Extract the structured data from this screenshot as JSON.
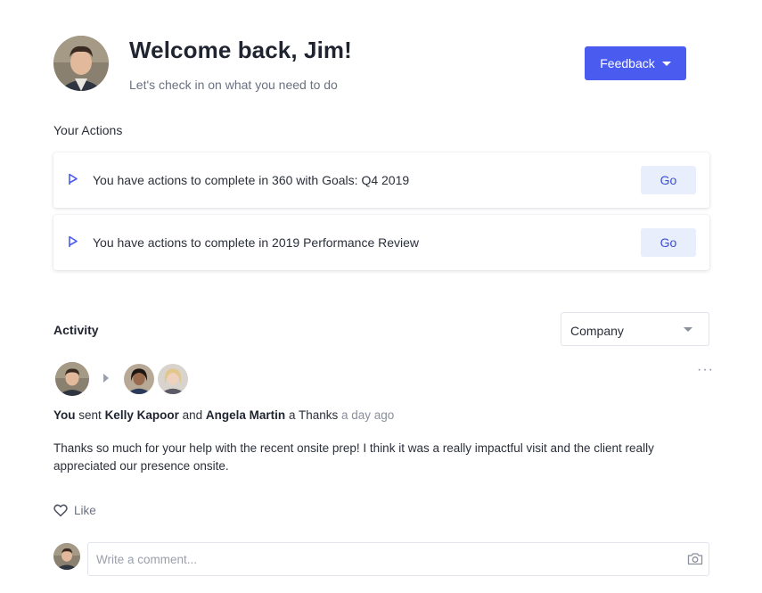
{
  "header": {
    "title": "Welcome back, Jim!",
    "subtitle": "Let's check in on what you need to do",
    "avatar_icon": "user-avatar-jim",
    "feedback_label": "Feedback",
    "accent_color": "#4a5bef"
  },
  "actions": {
    "heading": "Your Actions",
    "items": [
      {
        "text": "You have actions to complete in 360 with Goals: Q4 2019",
        "button": "Go",
        "icon": "flag-icon"
      },
      {
        "text": "You have actions to complete in 2019 Performance Review",
        "button": "Go",
        "icon": "flag-icon"
      }
    ]
  },
  "activity": {
    "heading": "Activity",
    "filter_value": "Company",
    "entry": {
      "sender": "You",
      "verb": "sent",
      "recipient_1": "Kelly Kapoor",
      "conjunction": "and",
      "recipient_2": "Angela Martin",
      "object": "a Thanks",
      "time": "a day ago",
      "message": "Thanks so much for your help with the recent onsite prep! I think it was a really impactful visit and the client really appreciated our presence onsite.",
      "like_label": "Like",
      "more_icon": "more-options-icon"
    },
    "comment": {
      "placeholder": "Write a comment...",
      "value": "",
      "camera_icon": "camera-icon"
    }
  }
}
